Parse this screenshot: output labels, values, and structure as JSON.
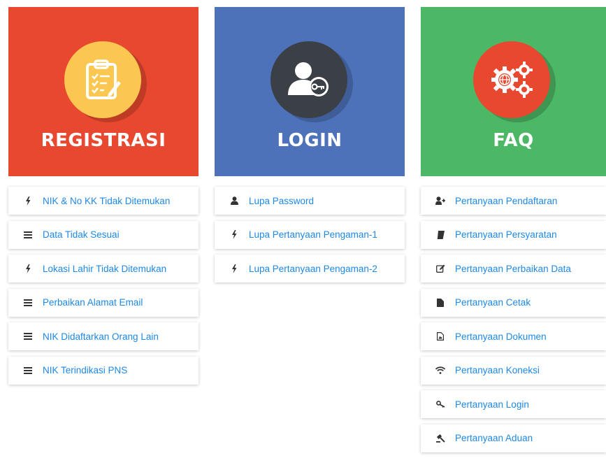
{
  "colors": {
    "registrasi": "#e8482f",
    "login": "#4d72ba",
    "faq": "#4cb865",
    "link": "#1e88e5",
    "icon": "#333333"
  },
  "registrasi": {
    "title": "REGISTRASI",
    "icon": "clipboard-icon",
    "items": [
      {
        "label": "NIK & No KK Tidak Ditemukan",
        "icon": "bolt-icon"
      },
      {
        "label": "Data Tidak Sesuai",
        "icon": "bars-icon"
      },
      {
        "label": "Lokasi Lahir Tidak Ditemukan",
        "icon": "bolt-icon"
      },
      {
        "label": "Perbaikan Alamat Email",
        "icon": "bars-icon"
      },
      {
        "label": "NIK Didaftarkan Orang Lain",
        "icon": "bars-icon"
      },
      {
        "label": "NIK Terindikasi PNS",
        "icon": "bars-icon"
      }
    ]
  },
  "login": {
    "title": "LOGIN",
    "icon": "user-key-icon",
    "items": [
      {
        "label": "Lupa Password",
        "icon": "user-icon"
      },
      {
        "label": "Lupa Pertanyaan Pengaman-1",
        "icon": "bolt-icon"
      },
      {
        "label": "Lupa Pertanyaan Pengaman-2",
        "icon": "bolt-icon"
      }
    ]
  },
  "faq": {
    "title": "FAQ",
    "icon": "gears-icon",
    "items": [
      {
        "label": "Pertanyaan Pendaftaran",
        "icon": "user-plus-icon"
      },
      {
        "label": "Pertanyaan Persyaratan",
        "icon": "book-icon"
      },
      {
        "label": "Pertanyaan Perbaikan Data",
        "icon": "edit-icon"
      },
      {
        "label": "Pertanyaan Cetak",
        "icon": "file-icon"
      },
      {
        "label": "Pertanyaan Dokumen",
        "icon": "file-image-icon"
      },
      {
        "label": "Pertanyaan Koneksi",
        "icon": "wifi-icon"
      },
      {
        "label": "Pertanyaan Login",
        "icon": "key-icon"
      },
      {
        "label": "Pertanyaan Aduan",
        "icon": "gavel-icon"
      }
    ]
  }
}
